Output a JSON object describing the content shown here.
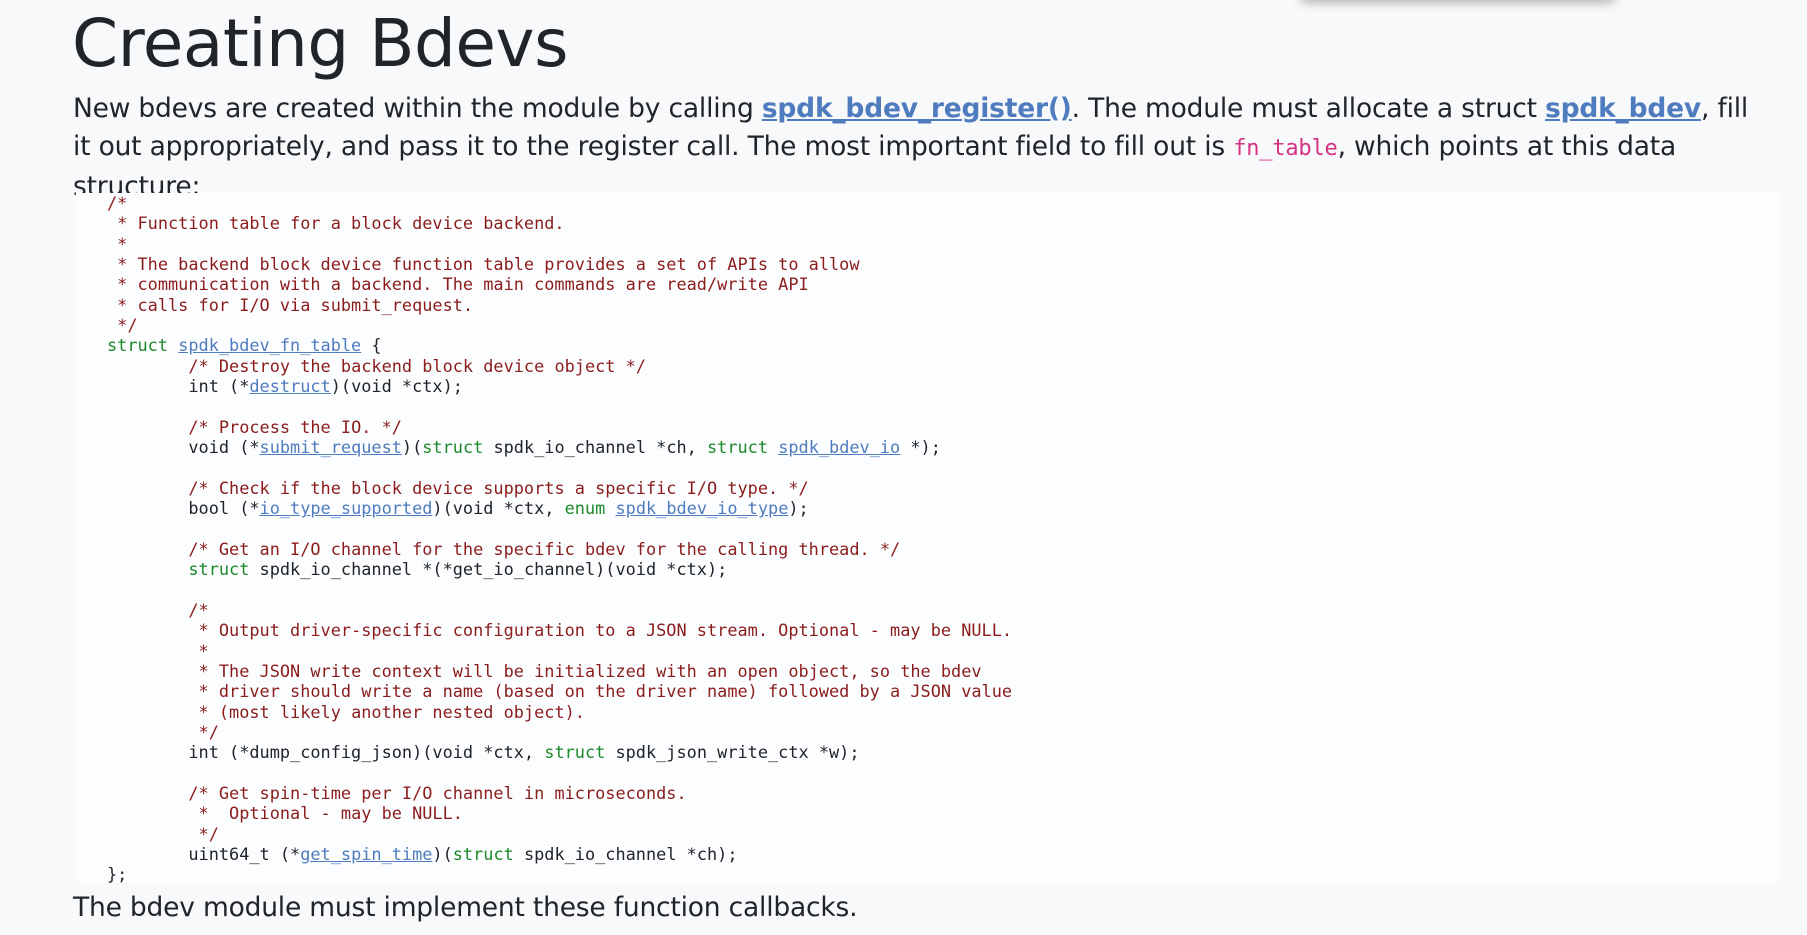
{
  "page": {
    "title": "Creating Bdevs",
    "intro": [
      {
        "type": "text",
        "text": "New bdevs are created within the module by calling "
      },
      {
        "type": "link",
        "text": "spdk_bdev_register()",
        "name": "link-spdk-bdev-register"
      },
      {
        "type": "text",
        "text": ". The module must allocate a struct "
      },
      {
        "type": "link",
        "text": "spdk_bdev",
        "name": "link-spdk-bdev"
      },
      {
        "type": "text",
        "text": ", fill it out appropriately, and pass it to the register call. The most important field to fill out is "
      },
      {
        "type": "code",
        "text": "fn_table",
        "name": "inline-code-fn-table"
      },
      {
        "type": "text",
        "text": ", which points at this data structure:"
      }
    ],
    "outro": "The bdev module must implement these function callbacks."
  },
  "code_block": {
    "lines": [
      [
        {
          "t": "cm",
          "v": "/*"
        }
      ],
      [
        {
          "t": "cm",
          "v": " * Function table for a block device backend."
        }
      ],
      [
        {
          "t": "cm",
          "v": " *"
        }
      ],
      [
        {
          "t": "cm",
          "v": " * The backend block device function table provides a set of APIs to allow"
        }
      ],
      [
        {
          "t": "cm",
          "v": " * communication with a backend. The main commands are read/write API"
        }
      ],
      [
        {
          "t": "cm",
          "v": " * calls for I/O via submit_request."
        }
      ],
      [
        {
          "t": "cm",
          "v": " */"
        }
      ],
      [
        {
          "t": "kw",
          "v": "struct "
        },
        {
          "t": "lk",
          "v": "spdk_bdev_fn_table"
        },
        {
          "t": "tx",
          "v": " {"
        }
      ],
      [
        {
          "t": "tx",
          "v": "        "
        },
        {
          "t": "cm",
          "v": "/* Destroy the backend block device object */"
        }
      ],
      [
        {
          "t": "tx",
          "v": "        int (*"
        },
        {
          "t": "lk",
          "v": "destruct"
        },
        {
          "t": "tx",
          "v": ")(void *ctx);"
        }
      ],
      [
        {
          "t": "tx",
          "v": ""
        }
      ],
      [
        {
          "t": "tx",
          "v": "        "
        },
        {
          "t": "cm",
          "v": "/* Process the IO. */"
        }
      ],
      [
        {
          "t": "tx",
          "v": "        void (*"
        },
        {
          "t": "lk",
          "v": "submit_request"
        },
        {
          "t": "tx",
          "v": ")("
        },
        {
          "t": "kw",
          "v": "struct"
        },
        {
          "t": "tx",
          "v": " spdk_io_channel *ch, "
        },
        {
          "t": "kw",
          "v": "struct"
        },
        {
          "t": "tx",
          "v": " "
        },
        {
          "t": "lk",
          "v": "spdk_bdev_io"
        },
        {
          "t": "tx",
          "v": " *);"
        }
      ],
      [
        {
          "t": "tx",
          "v": ""
        }
      ],
      [
        {
          "t": "tx",
          "v": "        "
        },
        {
          "t": "cm",
          "v": "/* Check if the block device supports a specific I/O type. */"
        }
      ],
      [
        {
          "t": "tx",
          "v": "        bool (*"
        },
        {
          "t": "lk",
          "v": "io_type_supported"
        },
        {
          "t": "tx",
          "v": ")(void *ctx, "
        },
        {
          "t": "kw",
          "v": "enum"
        },
        {
          "t": "tx",
          "v": " "
        },
        {
          "t": "lk",
          "v": "spdk_bdev_io_type"
        },
        {
          "t": "tx",
          "v": ");"
        }
      ],
      [
        {
          "t": "tx",
          "v": ""
        }
      ],
      [
        {
          "t": "tx",
          "v": "        "
        },
        {
          "t": "cm",
          "v": "/* Get an I/O channel for the specific bdev for the calling thread. */"
        }
      ],
      [
        {
          "t": "tx",
          "v": "        "
        },
        {
          "t": "kw",
          "v": "struct"
        },
        {
          "t": "tx",
          "v": " spdk_io_channel *(*get_io_channel)(void *ctx);"
        }
      ],
      [
        {
          "t": "tx",
          "v": ""
        }
      ],
      [
        {
          "t": "tx",
          "v": "        "
        },
        {
          "t": "cm",
          "v": "/*"
        }
      ],
      [
        {
          "t": "tx",
          "v": "        "
        },
        {
          "t": "cm",
          "v": " * Output driver-specific configuration to a JSON stream. Optional - may be NULL."
        }
      ],
      [
        {
          "t": "tx",
          "v": "        "
        },
        {
          "t": "cm",
          "v": " *"
        }
      ],
      [
        {
          "t": "tx",
          "v": "        "
        },
        {
          "t": "cm",
          "v": " * The JSON write context will be initialized with an open object, so the bdev"
        }
      ],
      [
        {
          "t": "tx",
          "v": "        "
        },
        {
          "t": "cm",
          "v": " * driver should write a name (based on the driver name) followed by a JSON value"
        }
      ],
      [
        {
          "t": "tx",
          "v": "        "
        },
        {
          "t": "cm",
          "v": " * (most likely another nested object)."
        }
      ],
      [
        {
          "t": "tx",
          "v": "        "
        },
        {
          "t": "cm",
          "v": " */"
        }
      ],
      [
        {
          "t": "tx",
          "v": "        int (*dump_config_json)(void *ctx, "
        },
        {
          "t": "kw",
          "v": "struct"
        },
        {
          "t": "tx",
          "v": " spdk_json_write_ctx *w);"
        }
      ],
      [
        {
          "t": "tx",
          "v": ""
        }
      ],
      [
        {
          "t": "tx",
          "v": "        "
        },
        {
          "t": "cm",
          "v": "/* Get spin-time per I/O channel in microseconds."
        }
      ],
      [
        {
          "t": "tx",
          "v": "        "
        },
        {
          "t": "cm",
          "v": " *  Optional - may be NULL."
        }
      ],
      [
        {
          "t": "tx",
          "v": "        "
        },
        {
          "t": "cm",
          "v": " */"
        }
      ],
      [
        {
          "t": "tx",
          "v": "        uint64_t (*"
        },
        {
          "t": "lk",
          "v": "get_spin_time"
        },
        {
          "t": "tx",
          "v": ")("
        },
        {
          "t": "kw",
          "v": "struct"
        },
        {
          "t": "tx",
          "v": " spdk_io_channel *ch);"
        }
      ],
      [
        {
          "t": "tx",
          "v": "};"
        }
      ]
    ]
  },
  "colors": {
    "page_background": "#f8f9fa",
    "code_background": "#fcfdfe",
    "link": "#4f7cbf",
    "comment": "#8b1c1c",
    "keyword": "#1c8a2a",
    "inline_code": "#d63384"
  }
}
